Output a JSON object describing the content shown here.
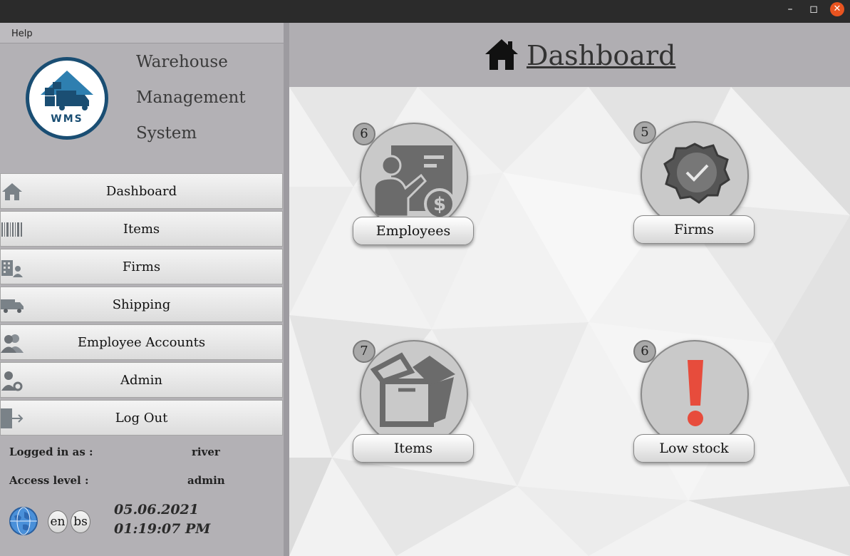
{
  "window": {
    "min": "–",
    "max": "◻",
    "close": "✕"
  },
  "menu": {
    "help": "Help"
  },
  "logo": {
    "text": "WMS"
  },
  "brand": {
    "line1": "Warehouse",
    "line2": "Management",
    "line3": "System"
  },
  "nav": {
    "dashboard": "Dashboard",
    "items": "Items",
    "firms": "Firms",
    "shipping": "Shipping",
    "employee_accounts": "Employee Accounts",
    "admin": "Admin",
    "logout": "Log Out"
  },
  "session": {
    "logged_in_label": "Logged in as :",
    "logged_in_value": "river",
    "access_label": "Access level :",
    "access_value": "admin",
    "date": "05.06.2021",
    "time": "01:19:07 PM"
  },
  "languages": {
    "en": "en",
    "bs": "bs"
  },
  "header": {
    "title": "Dashboard",
    "icon": "home-icon"
  },
  "tiles": {
    "employees": {
      "label": "Employees",
      "count": "6",
      "icon": "employee-presentation-icon"
    },
    "firms": {
      "label": "Firms",
      "count": "5",
      "icon": "verified-badge-icon"
    },
    "items": {
      "label": "Items",
      "count": "7",
      "icon": "open-box-icon"
    },
    "low_stock": {
      "label": "Low stock",
      "count": "6",
      "icon": "exclamation-icon"
    }
  },
  "colors": {
    "accent": "#1a4e73",
    "close": "#e95420",
    "alert": "#e74c3c",
    "icon_gray": "#6b6b6b"
  }
}
